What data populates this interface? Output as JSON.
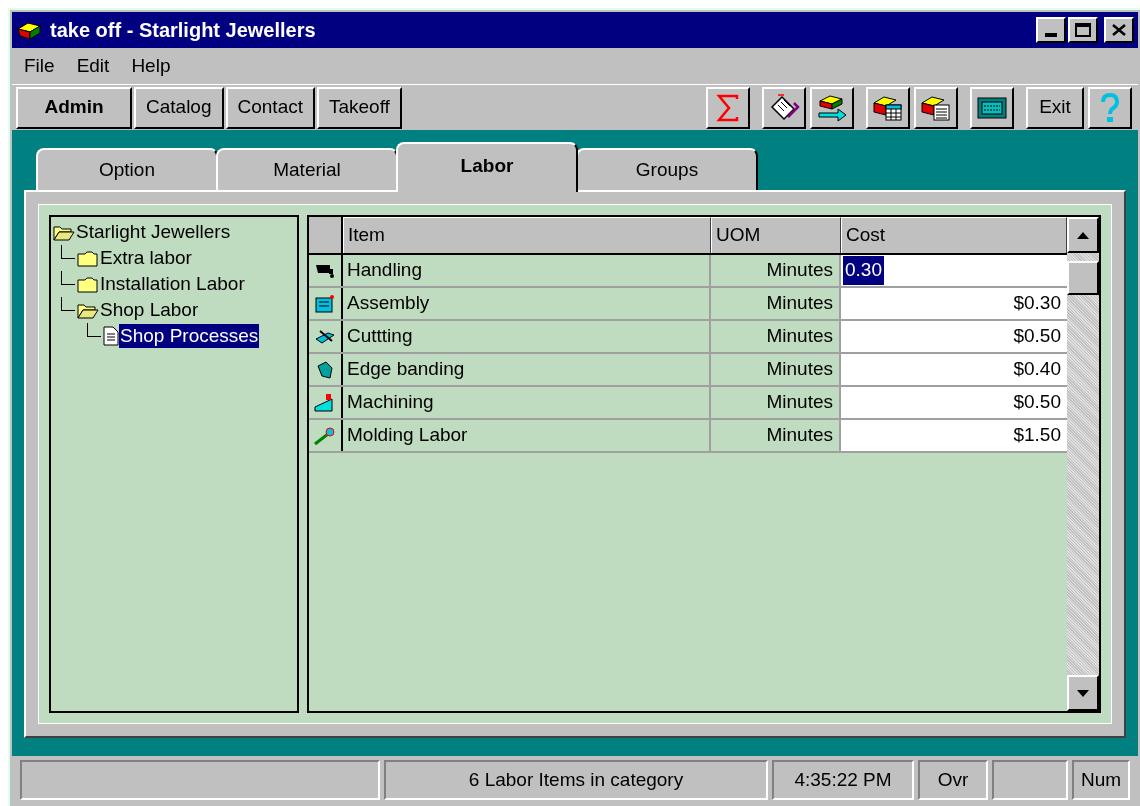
{
  "window": {
    "title": "take off - Starlight Jewellers"
  },
  "menu": [
    "File",
    "Edit",
    "Help"
  ],
  "nav_buttons": [
    {
      "label": "Admin",
      "selected": true
    },
    {
      "label": "Catalog",
      "selected": false
    },
    {
      "label": "Contact",
      "selected": false
    },
    {
      "label": "Takeoff",
      "selected": false
    }
  ],
  "toolbar_exit": "Exit",
  "tabs": [
    {
      "label": "Option",
      "selected": false
    },
    {
      "label": "Material",
      "selected": false
    },
    {
      "label": "Labor",
      "selected": true
    },
    {
      "label": "Groups",
      "selected": false
    }
  ],
  "tree": [
    {
      "label": "Starlight Jewellers",
      "kind": "folder",
      "expanded": true,
      "selected": false,
      "children": [
        {
          "label": "Extra labor",
          "kind": "folder",
          "expanded": false,
          "selected": false
        },
        {
          "label": "Installation Labor",
          "kind": "folder",
          "expanded": false,
          "selected": false
        },
        {
          "label": "Shop Labor",
          "kind": "folder",
          "expanded": true,
          "selected": false,
          "children": [
            {
              "label": "Shop Processes",
              "kind": "document",
              "selected": true
            }
          ]
        }
      ]
    }
  ],
  "table": {
    "columns": [
      "Item",
      "UOM",
      "Cost"
    ],
    "rows": [
      {
        "item": "Handling",
        "uom": "Minutes",
        "cost": "0.30",
        "editing": true
      },
      {
        "item": "Assembly",
        "uom": "Minutes",
        "cost": "$0.30",
        "editing": false
      },
      {
        "item": "Cuttting",
        "uom": "Minutes",
        "cost": "$0.50",
        "editing": false
      },
      {
        "item": "Edge banding",
        "uom": "Minutes",
        "cost": "$0.40",
        "editing": false
      },
      {
        "item": "Machining",
        "uom": "Minutes",
        "cost": "$0.50",
        "editing": false
      },
      {
        "item": "Molding Labor",
        "uom": "Minutes",
        "cost": "$1.50",
        "editing": false
      }
    ]
  },
  "status_bar": [
    {
      "kind": "blank"
    },
    {
      "kind": "text",
      "text": "6 Labor Items in category"
    },
    {
      "kind": "text",
      "text": "4:35:22 PM"
    },
    {
      "kind": "text",
      "text": "Ovr"
    },
    {
      "kind": "blank"
    },
    {
      "kind": "text",
      "text": "Num"
    }
  ]
}
